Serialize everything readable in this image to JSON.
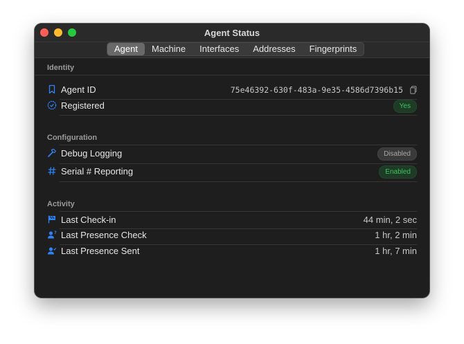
{
  "window": {
    "title": "Agent Status"
  },
  "tabs": [
    {
      "label": "Agent"
    },
    {
      "label": "Machine"
    },
    {
      "label": "Interfaces"
    },
    {
      "label": "Addresses"
    },
    {
      "label": "Fingerprints"
    }
  ],
  "identity": {
    "header": "Identity",
    "agent_id": {
      "label": "Agent ID",
      "value": "75e46392-630f-483a-9e35-4586d7396b15",
      "icon": "bookmark-icon"
    },
    "registered": {
      "label": "Registered",
      "value": "Yes",
      "icon": "checkmark-seal-icon"
    }
  },
  "configuration": {
    "header": "Configuration",
    "debug_logging": {
      "label": "Debug Logging",
      "value": "Disabled",
      "icon": "hammer-icon"
    },
    "serial_reporting": {
      "label": "Serial # Reporting",
      "value": "Enabled",
      "icon": "number-sign-icon"
    }
  },
  "activity": {
    "header": "Activity",
    "last_checkin": {
      "label": "Last Check-in",
      "value": "44 min, 2 sec",
      "icon": "flag-icon"
    },
    "last_presence_check": {
      "label": "Last Presence Check",
      "value": "1 hr, 2 min",
      "icon": "person-question-icon"
    },
    "last_presence_sent": {
      "label": "Last Presence Sent",
      "value": "1 hr, 7 min",
      "icon": "person-check-icon"
    }
  },
  "colors": {
    "accent": "#2f83f5",
    "badge_green": "#3fc35f",
    "window_bg": "#1e1e1e"
  }
}
